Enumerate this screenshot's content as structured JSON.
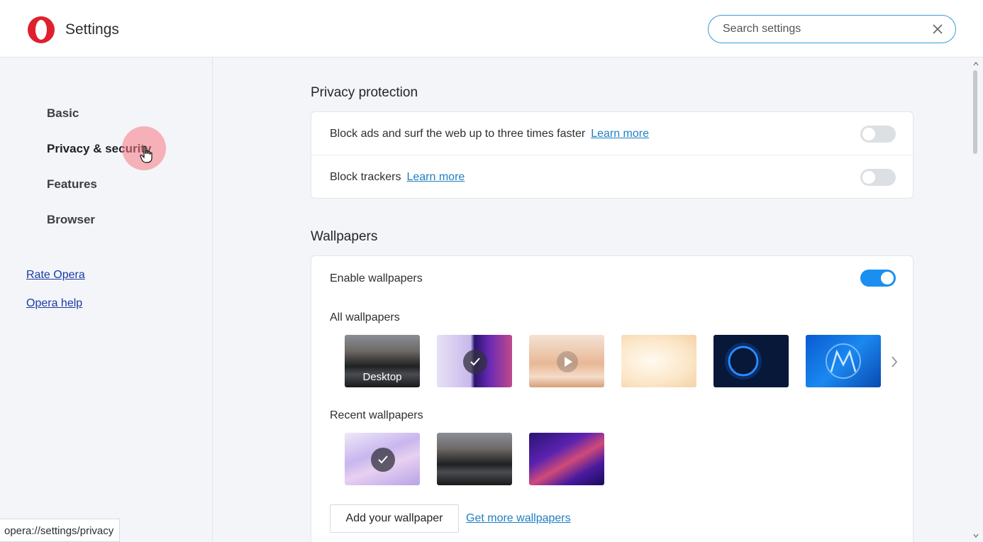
{
  "header": {
    "title": "Settings",
    "search_placeholder": "Search settings"
  },
  "sidebar": {
    "items": [
      {
        "label": "Basic"
      },
      {
        "label": "Privacy & security"
      },
      {
        "label": "Features"
      },
      {
        "label": "Browser"
      }
    ],
    "links": [
      {
        "label": "Rate Opera"
      },
      {
        "label": "Opera help"
      }
    ]
  },
  "privacy": {
    "title": "Privacy protection",
    "block_ads_label": "Block ads and surf the web up to three times faster",
    "block_ads_link": "Learn more",
    "block_ads_enabled": false,
    "block_trackers_label": "Block trackers",
    "block_trackers_link": "Learn more",
    "block_trackers_enabled": false
  },
  "wallpapers": {
    "title": "Wallpapers",
    "enable_label": "Enable wallpapers",
    "enabled": true,
    "all_label": "All wallpapers",
    "all_items": [
      {
        "caption": "Desktop",
        "style": "mountain"
      },
      {
        "caption": "",
        "style": "purple-split",
        "selected": true
      },
      {
        "caption": "",
        "style": "peach-video"
      },
      {
        "caption": "",
        "style": "cream"
      },
      {
        "caption": "",
        "style": "dark-ring"
      },
      {
        "caption": "",
        "style": "blue-logo"
      }
    ],
    "recent_label": "Recent wallpapers",
    "recent_items": [
      {
        "style": "lilac",
        "selected": true
      },
      {
        "style": "mountain"
      },
      {
        "style": "purple-wave"
      }
    ],
    "add_button": "Add your wallpaper",
    "more_link": "Get more wallpapers"
  },
  "status_bar": {
    "url": "opera://settings/privacy"
  },
  "colors": {
    "accent": "#1a8ff0",
    "link": "#1f7fc2",
    "opera_red": "#e0202d"
  }
}
